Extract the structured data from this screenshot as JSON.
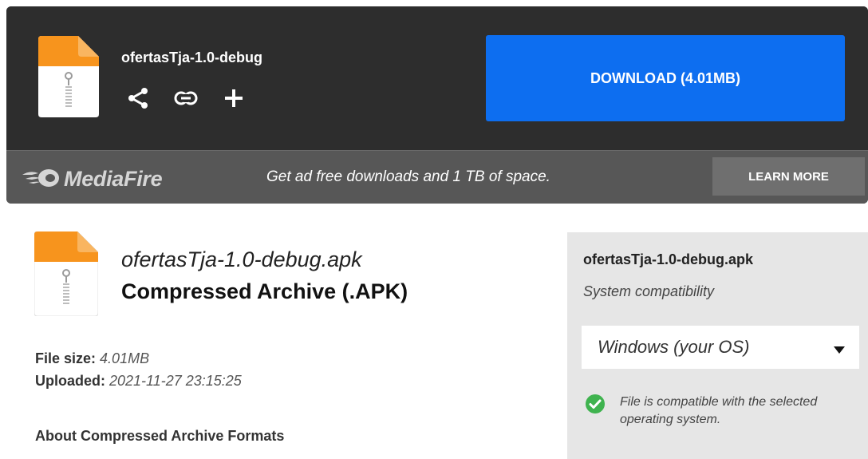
{
  "header": {
    "filename": "ofertasTja-1.0-debug",
    "actions": [
      {
        "icon": "share-icon"
      },
      {
        "icon": "link-icon"
      },
      {
        "icon": "plus-icon"
      }
    ],
    "download_label": "DOWNLOAD (4.01MB)"
  },
  "promo": {
    "logo_text": "MediaFire",
    "message": "Get ad free downloads and 1 TB of space.",
    "learn_more_label": "LEARN MORE"
  },
  "file": {
    "name": "ofertasTja-1.0-debug.apk",
    "type_label": "Compressed Archive (.APK)",
    "size_label": "File size:",
    "size_value": "4.01MB",
    "uploaded_label": "Uploaded:",
    "uploaded_value": "2021-11-27 23:15:25",
    "about_link": "About Compressed Archive Formats"
  },
  "compatibility": {
    "filename": "ofertasTja-1.0-debug.apk",
    "label": "System compatibility",
    "selected_os": "Windows (your OS)",
    "status_text": "File is compatible with the selected operating system.",
    "status_color": "#3fb34f"
  },
  "colors": {
    "download_button": "#0d6ef0",
    "icon_orange": "#f7941d",
    "panel_dark": "#2d2d2d"
  }
}
